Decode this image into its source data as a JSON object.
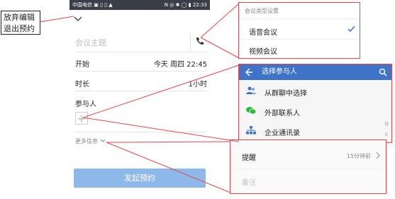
{
  "callout": {
    "line1": "放弃编辑",
    "line2": "退出预约"
  },
  "status": {
    "carrier": "中国电信 ▣ ▯ ▯ ▲",
    "right": "N ◎ ✱ ◯ ▮ 22:33"
  },
  "form": {
    "topic_placeholder": "会议主题",
    "start_label": "开始",
    "start_value": "今天 周四 22:45",
    "duration_label": "时长",
    "duration_value": "1小时",
    "participants_label": "参与人",
    "more_info": "更多信息",
    "submit": "发起预约"
  },
  "meeting_type": {
    "title": "会议类型设置",
    "options": [
      {
        "label": "语音会议"
      },
      {
        "label": "视频会议"
      }
    ]
  },
  "participants_panel": {
    "title": "选择参与人",
    "items": [
      {
        "label": "从群聊中选择"
      },
      {
        "label": "外部联系人"
      },
      {
        "label": "企业通讯录"
      }
    ],
    "index_letters": [
      "Q",
      "B"
    ]
  },
  "reminder": {
    "label": "提醒",
    "value": "15分钟前",
    "notes_placeholder": "备注"
  },
  "colors": {
    "accent": "#3e73c8",
    "callout_border": "#e4484b",
    "button": "#8fb8ea"
  }
}
